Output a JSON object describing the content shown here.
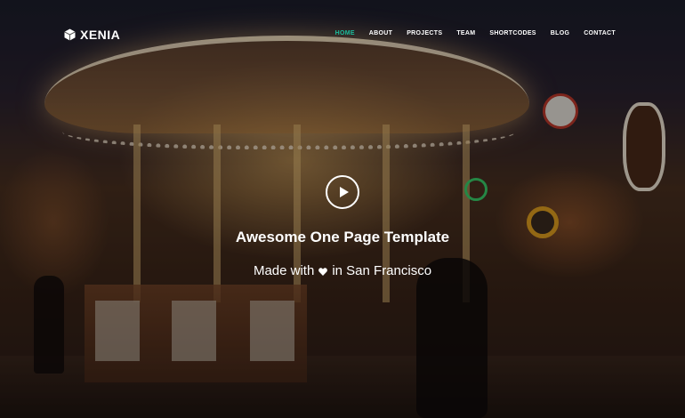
{
  "brand": {
    "name": "XENIA",
    "icon": "hexagon-cube-icon"
  },
  "nav": {
    "items": [
      {
        "label": "HOME",
        "active": true
      },
      {
        "label": "ABOUT",
        "active": false
      },
      {
        "label": "PROJECTS",
        "active": false
      },
      {
        "label": "TEAM",
        "active": false
      },
      {
        "label": "SHORTCODES",
        "active": false
      },
      {
        "label": "BLOG",
        "active": false
      },
      {
        "label": "CONTACT",
        "active": false
      }
    ],
    "active_color": "#1bbc9b"
  },
  "hero": {
    "play_icon": "play-icon",
    "headline": "Awesome One Page Template",
    "subline_before": "Made with",
    "subline_icon": "heart-icon",
    "subline_after": "in San Francisco"
  }
}
